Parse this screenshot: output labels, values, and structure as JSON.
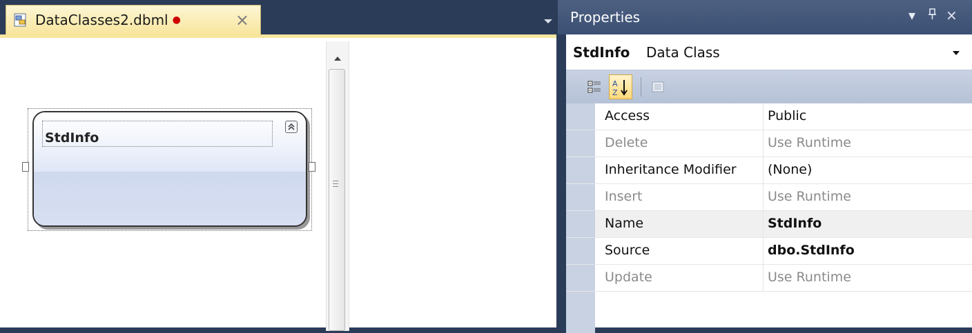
{
  "document_tab": {
    "label": "DataClasses2.dbml",
    "close_glyph": "×"
  },
  "designer": {
    "entity_name": "StdInfo",
    "collapse_glyph": "⌃"
  },
  "properties": {
    "title": "Properties",
    "title_buttons": {
      "menu": "▾",
      "pin": "⊣",
      "close": "×"
    },
    "object_name": "StdInfo",
    "object_type": "Data Class",
    "toolbar": {
      "categorized_icon": "categorized-icon",
      "alphabetical_icon": "alphabetical-icon",
      "pages_icon": "property-pages-icon"
    },
    "rows": [
      {
        "name": "Access",
        "value": "Public"
      },
      {
        "name": "Delete",
        "value": "Use Runtime"
      },
      {
        "name": "Inheritance Modifier",
        "value": "(None)"
      },
      {
        "name": "Insert",
        "value": "Use Runtime"
      },
      {
        "name": "Name",
        "value": "StdInfo"
      },
      {
        "name": "Source",
        "value": "dbo.StdInfo"
      },
      {
        "name": "Update",
        "value": "Use Runtime"
      }
    ]
  },
  "colors": {
    "chrome": "#2b3c59",
    "tab_active": "#f8e59d",
    "toolbar": "#c8d2e3",
    "entity_fill": "#d8e0f2",
    "dirty_dot": "#cc0000"
  }
}
